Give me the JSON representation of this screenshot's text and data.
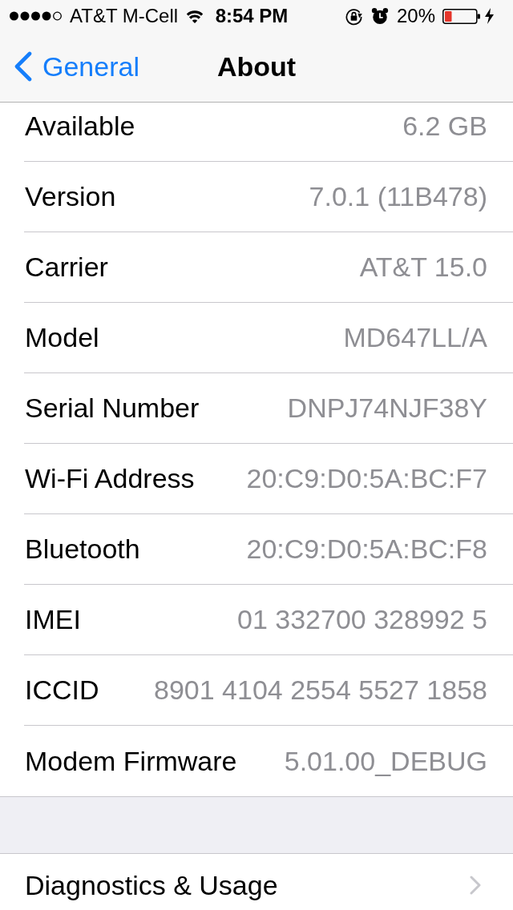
{
  "status_bar": {
    "carrier": "AT&T M-Cell",
    "time": "8:54 PM",
    "battery_percent": "20%"
  },
  "nav_bar": {
    "back_label": "General",
    "title": "About"
  },
  "groups": [
    {
      "rows": [
        {
          "kind": "info",
          "label": "Available",
          "value": "6.2 GB"
        },
        {
          "kind": "info",
          "label": "Version",
          "value": "7.0.1 (11B478)"
        },
        {
          "kind": "info",
          "label": "Carrier",
          "value": "AT&T 15.0"
        },
        {
          "kind": "info",
          "label": "Model",
          "value": "MD647LL/A"
        },
        {
          "kind": "info",
          "label": "Serial Number",
          "value": "DNPJ74NJF38Y"
        },
        {
          "kind": "info",
          "label": "Wi-Fi Address",
          "value": "20:C9:D0:5A:BC:F7"
        },
        {
          "kind": "info",
          "label": "Bluetooth",
          "value": "20:C9:D0:5A:BC:F8"
        },
        {
          "kind": "info",
          "label": "IMEI",
          "value": "01 332700 328992 5"
        },
        {
          "kind": "info",
          "label": "ICCID",
          "value": "8901 4104 2554 5527 1858"
        },
        {
          "kind": "info",
          "label": "Modem Firmware",
          "value": "5.01.00_DEBUG"
        }
      ]
    },
    {
      "rows": [
        {
          "kind": "link",
          "label": "Diagnostics & Usage"
        }
      ]
    }
  ]
}
